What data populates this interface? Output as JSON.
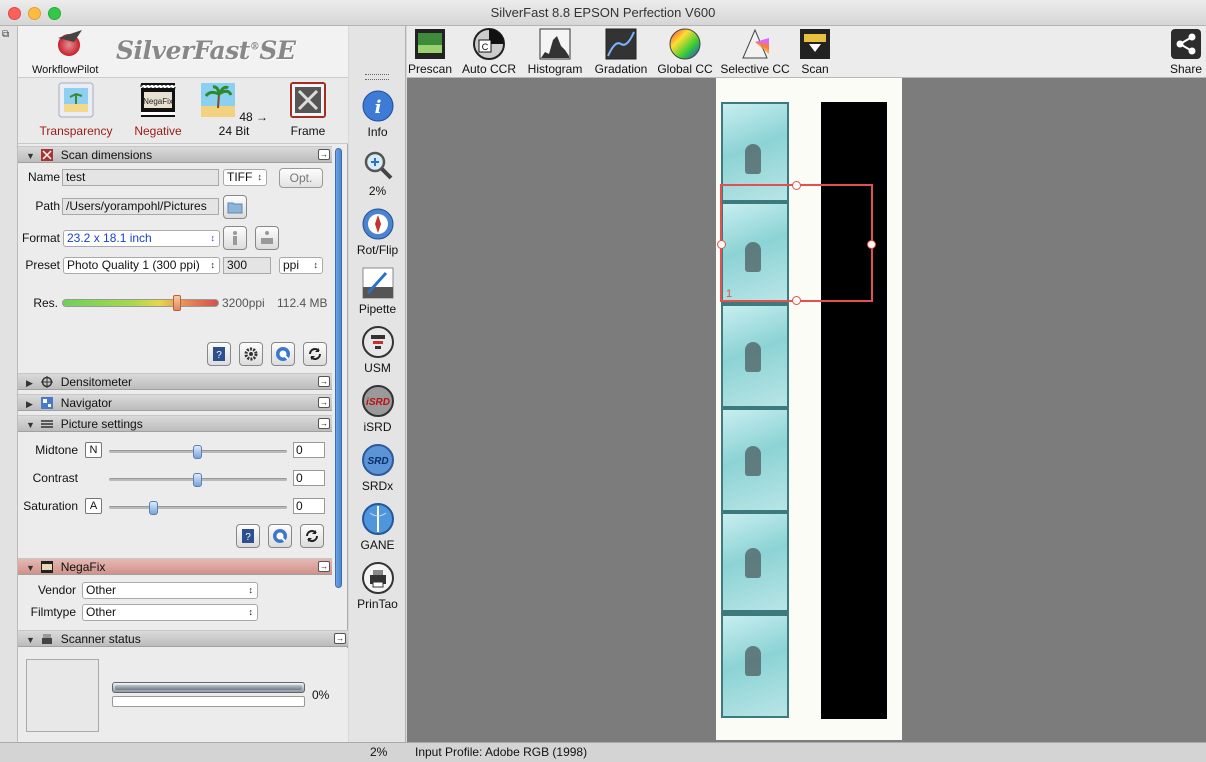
{
  "window": {
    "title": "SilverFast 8.8 EPSON Perfection V600"
  },
  "brand": {
    "workflow_label": "WorkflowPilot",
    "logo_text": "SilverFast",
    "logo_suffix": "SE"
  },
  "modes": [
    {
      "label": "Transparency",
      "active": true,
      "icon": "slide-icon"
    },
    {
      "label": "Negative",
      "active": true,
      "icon": "negafix-icon"
    },
    {
      "label": "48 → 24 Bit",
      "active": false,
      "icon": "palm-icon"
    },
    {
      "label": "Frame",
      "active": false,
      "icon": "frame-tools-icon"
    }
  ],
  "sections": {
    "scan_dimensions": "Scan dimensions",
    "densitometer": "Densitometer",
    "navigator": "Navigator",
    "picture_settings": "Picture settings",
    "negafix": "NegaFix",
    "scanner_status": "Scanner status"
  },
  "scan": {
    "name_label": "Name",
    "name_value": "test",
    "format_type": "TIFF",
    "opt_button": "Opt.",
    "path_label": "Path",
    "path_value": "/Users/yorampohl/Pictures",
    "format_label": "Format",
    "format_value": "23.2 x 18.1 inch",
    "preset_label": "Preset",
    "preset_value": "Photo Quality 1 (300 ppi)",
    "ppi_value": "300",
    "ppi_unit": "ppi",
    "res_label": "Res.",
    "res_value": "3200ppi",
    "file_size": "112.4 MB"
  },
  "picture": {
    "midtone_label": "Midtone",
    "midtone_key": "N",
    "midtone_value": "0",
    "midtone_pos": 0.5,
    "contrast_label": "Contrast",
    "contrast_value": "0",
    "contrast_pos": 0.5,
    "saturation_label": "Saturation",
    "saturation_key": "A",
    "saturation_value": "0",
    "saturation_pos": 0.25
  },
  "negafix": {
    "vendor_label": "Vendor",
    "vendor_value": "Other",
    "filmtype_label": "Filmtype",
    "filmtype_value": "Other"
  },
  "status": {
    "progress_text": "0%",
    "progress": 0
  },
  "tools": [
    {
      "label": "Info",
      "icon": "info-icon"
    },
    {
      "label": "2%",
      "icon": "zoom-icon"
    },
    {
      "label": "Rot/Flip",
      "icon": "compass-icon"
    },
    {
      "label": "Pipette",
      "icon": "pipette-icon"
    },
    {
      "label": "USM",
      "icon": "usm-icon"
    },
    {
      "label": "iSRD",
      "icon": "isrd-icon"
    },
    {
      "label": "SRDx",
      "icon": "srdx-icon"
    },
    {
      "label": "GANE",
      "icon": "gane-icon"
    },
    {
      "label": "PrinTao",
      "icon": "printao-icon"
    }
  ],
  "toolbar": [
    {
      "label": "Prescan",
      "icon": "prescan-icon"
    },
    {
      "label": "Auto CCR",
      "icon": "auto-ccr-icon"
    },
    {
      "label": "Histogram",
      "icon": "histogram-icon"
    },
    {
      "label": "Gradation",
      "icon": "gradation-icon"
    },
    {
      "label": "Global CC",
      "icon": "color-wheel-icon"
    },
    {
      "label": "Selective CC",
      "icon": "prism-icon"
    },
    {
      "label": "Scan",
      "icon": "scan-icon"
    },
    {
      "label": "Share",
      "icon": "share-icon"
    }
  ],
  "preview": {
    "frame_number": "1"
  },
  "bottom": {
    "zoom": "2%",
    "profile": "Input Profile: Adobe RGB (1998)"
  },
  "colors": {
    "accent_red": "#9b1a14",
    "selection": "#e25050",
    "slider_blue": "#4a83d0"
  }
}
